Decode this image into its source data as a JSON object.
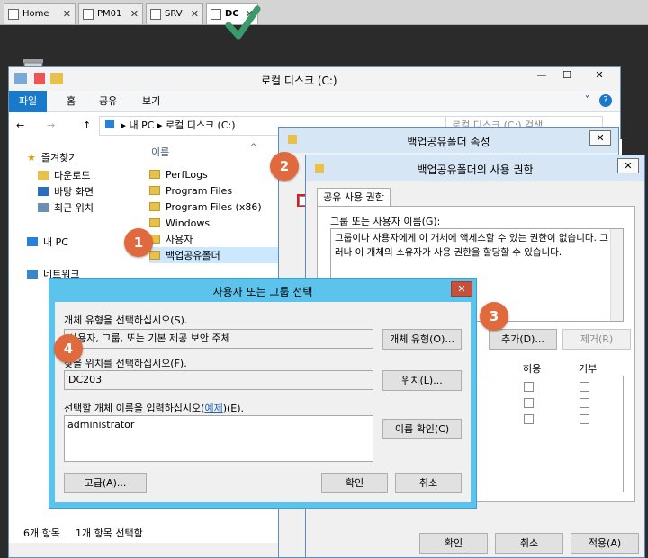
{
  "vm_tabs": [
    {
      "label": "Home",
      "close": "✕"
    },
    {
      "label": "PM01",
      "close": "✕"
    },
    {
      "label": "SRV",
      "close": "✕"
    },
    {
      "label": "DC",
      "close": "✕"
    }
  ],
  "explorer": {
    "title": "로컬 디스크 (C:)",
    "ribbon": [
      "파일",
      "홈",
      "공유",
      "보기"
    ],
    "address": [
      "내 PC",
      "로컬 디스크 (C:)"
    ],
    "search_placeholder": "로컬 디스크 (C:) 검색",
    "nav": {
      "favorites": "즐겨찾기",
      "downloads": "다운로드",
      "desktop": "바탕 화면",
      "recent": "최근 위치",
      "this_pc": "내 PC",
      "network": "네트워크"
    },
    "column_name": "이름",
    "files": [
      "PerfLogs",
      "Program Files",
      "Program Files (x86)",
      "Windows",
      "사용자",
      "백업공유폴더"
    ],
    "status_count": "6개 항목",
    "status_selected": "1개 항목 선택함"
  },
  "props_dialog": {
    "title": "백업공유폴더 속성"
  },
  "perm_dialog": {
    "title": "백업공유폴더의 사용 권한",
    "tab": "공유 사용 권한",
    "group_label": "그룹 또는 사용자 이름(G):",
    "message": "그룹이나 사용자에게 이 개체에 액세스할 수 있는 권한이 없습니다. 그러나 이 개체의 소유자가 사용 권한을 할당할 수 있습니다.",
    "add_button": "추가(D)...",
    "remove_button": "제거(R)",
    "allow_header": "허용",
    "deny_header": "거부",
    "ok_button": "확인",
    "cancel_button": "취소",
    "apply_button": "적용(A)"
  },
  "select_dialog": {
    "title": "사용자 또는 그룹 선택",
    "object_type_label": "개체 유형을 선택하십시오(S).",
    "object_type_value": "사용자, 그룹, 또는 기본 제공 보안 주체",
    "object_type_button": "개체 유형(O)...",
    "location_label": "찾을 위치를 선택하십시오(F).",
    "location_value": "DC203",
    "location_button": "위치(L)...",
    "enter_label_pre": "선택할 개체 이름을 입력하십시오(",
    "enter_label_link": "예제",
    "enter_label_post": ")(E).",
    "enter_value": "administrator",
    "check_names_button": "이름 확인(C)",
    "advanced_button": "고급(A)...",
    "ok_button": "확인",
    "cancel_button": "취소"
  },
  "annotations": [
    "1",
    "2",
    "3",
    "4"
  ],
  "colors": {
    "accent": "#1979ca",
    "badge": "#e06a3d",
    "dialog_title": "#5cc4ec",
    "check": "#2e8b57"
  }
}
